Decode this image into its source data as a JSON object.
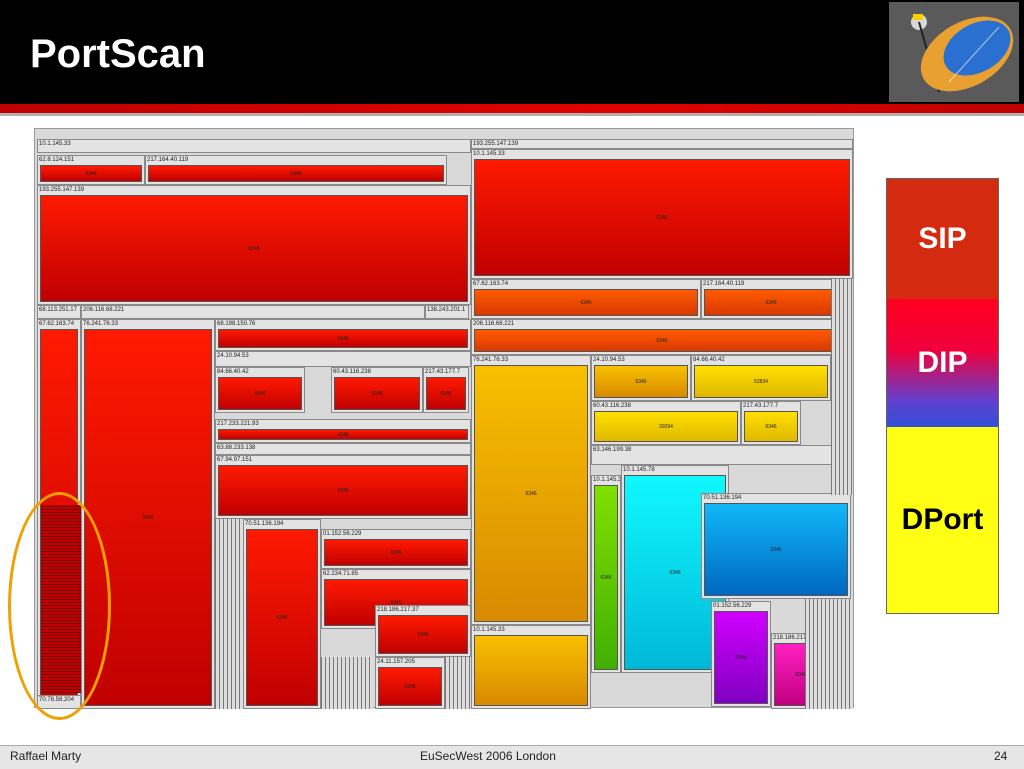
{
  "slide": {
    "title": "PortScan",
    "footer_left": "Raffael Marty",
    "footer_center": "EuSecWest 2006 London",
    "page_number": "24"
  },
  "legend": {
    "items": [
      "SIP",
      "DIP",
      "DPort"
    ],
    "colors": {
      "sip": "#d42a10",
      "dip_top": "#ff0020",
      "dip_bottom": "#3050d8",
      "dport": "#ffff14"
    }
  },
  "treemap": {
    "cells": [
      {
        "id": "a1",
        "label": "10.1.145.33",
        "value": ""
      },
      {
        "id": "a2",
        "label": "62.8.124.151",
        "value": "6346"
      },
      {
        "id": "a3",
        "label": "217.164.40.119",
        "value": "6346"
      },
      {
        "id": "a4",
        "label": "193.255.147.139",
        "value": "6346"
      },
      {
        "id": "b1",
        "label": "193.255.147.139",
        "value": ""
      },
      {
        "id": "b2",
        "label": "10.1.145.33",
        "value": "6346"
      },
      {
        "id": "b3",
        "label": "67.62.163.74",
        "value": "6346"
      },
      {
        "id": "b4",
        "label": "217.164.40.119",
        "value": "6346"
      },
      {
        "id": "b5",
        "label": "206.116.68.221",
        "value": "6346"
      },
      {
        "id": "c1",
        "label": "68.113.251.17",
        "value": ""
      },
      {
        "id": "c2",
        "label": "206.116.68.221",
        "value": ""
      },
      {
        "id": "c3",
        "label": "138.243.201.1",
        "value": ""
      },
      {
        "id": "c4",
        "label": "67.62.163.74",
        "value": "6346"
      },
      {
        "id": "c5",
        "label": "76.241.76.33",
        "value": "6346"
      },
      {
        "id": "c6",
        "label": "68.198.150.76",
        "value": "6346"
      },
      {
        "id": "c7",
        "label": "24.10.94.53",
        "value": "6346"
      },
      {
        "id": "c8",
        "label": "84.66.40.42",
        "value": "6346"
      },
      {
        "id": "c9",
        "label": "60.43.116.238",
        "value": "6346"
      },
      {
        "id": "c10",
        "label": "217.43.177.7",
        "value": "6346"
      },
      {
        "id": "c11",
        "label": "217.233.221.93",
        "value": "6346"
      },
      {
        "id": "c12",
        "label": "63.88.233.138",
        "value": ""
      },
      {
        "id": "c13",
        "label": "67.94.97.151",
        "value": "6346"
      },
      {
        "id": "c14",
        "label": "70.51.136.194",
        "value": "6346"
      },
      {
        "id": "c15",
        "label": "01.152.56.229",
        "value": "6346"
      },
      {
        "id": "c16",
        "label": "62.234.71.85",
        "value": "6346"
      },
      {
        "id": "c17",
        "label": "218.186.217.37",
        "value": "6346"
      },
      {
        "id": "c18",
        "label": "24.11.157.205",
        "value": "6346"
      },
      {
        "id": "c19",
        "label": "70.78.58.204",
        "value": ""
      },
      {
        "id": "d1",
        "label": "76.241.76.33",
        "value": "6346"
      },
      {
        "id": "d2",
        "label": "10.1.145.33",
        "value": ""
      },
      {
        "id": "d3",
        "label": "24.10.94.53",
        "value": "6346"
      },
      {
        "id": "d4",
        "label": "84.66.40.42",
        "value": "52834"
      },
      {
        "id": "d5",
        "label": "60.43.116.238",
        "value": "39294"
      },
      {
        "id": "d6",
        "label": "217.43.177.7",
        "value": "6346"
      },
      {
        "id": "d7",
        "label": "63.146.199.38",
        "value": ""
      },
      {
        "id": "d8",
        "label": "10.1.145.78",
        "value": "6346"
      },
      {
        "id": "d9",
        "label": "10.1.145.33",
        "value": "6346"
      },
      {
        "id": "d10",
        "label": "70.51.136.194",
        "value": "6346"
      },
      {
        "id": "d11",
        "label": "01.152.56.229",
        "value": "6346"
      },
      {
        "id": "d12",
        "label": "218.186.217.37",
        "value": "6346"
      },
      {
        "id": "d13",
        "label": "68.198.150.76",
        "value": "6346"
      }
    ]
  }
}
